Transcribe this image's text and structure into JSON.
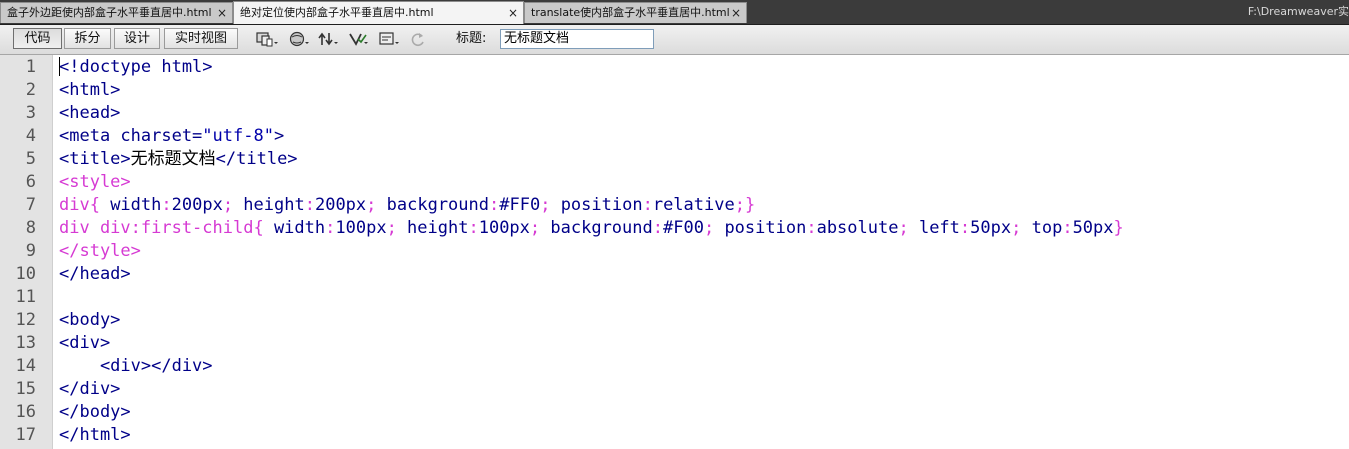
{
  "tabs": [
    {
      "label": "盒子外边距使内部盒子水平垂直居中.html",
      "close": "×",
      "active": false
    },
    {
      "label": "绝对定位使内部盒子水平垂直居中.html",
      "close": "×",
      "active": true
    },
    {
      "label": "translate使内部盒子水平垂直居中.html",
      "close": "×",
      "active": false
    }
  ],
  "site_path": "F:\\Dreamweaver实",
  "toolbar": {
    "view_buttons": [
      "代码",
      "拆分",
      "设计",
      "实时视图"
    ],
    "selected_view": "代码",
    "icons": [
      "multiscreen-icon",
      "preview-browser-icon",
      "file-management-icon",
      "validate-icon",
      "visual-aids-icon",
      "refresh-icon"
    ],
    "title_label": "标题:",
    "title_value": "无标题文档"
  },
  "editor": {
    "line_numbers": [
      "1",
      "2",
      "3",
      "4",
      "5",
      "6",
      "7",
      "8",
      "9",
      "10",
      "11",
      "12",
      "13",
      "14",
      "15",
      "16",
      "17"
    ],
    "colors": {
      "tag": "#000088",
      "style": "#d63ad3",
      "text": "#000000"
    },
    "lines": [
      [
        {
          "t": "<!doctype html>",
          "c": "tag"
        }
      ],
      [
        {
          "t": "<html>",
          "c": "tag"
        }
      ],
      [
        {
          "t": "<head>",
          "c": "tag"
        }
      ],
      [
        {
          "t": "<meta charset=",
          "c": "tag"
        },
        {
          "t": "\"utf-8\"",
          "c": "val"
        },
        {
          "t": ">",
          "c": "tag"
        }
      ],
      [
        {
          "t": "<title>",
          "c": "tag"
        },
        {
          "t": "无标题文档",
          "c": "text"
        },
        {
          "t": "</title>",
          "c": "tag"
        }
      ],
      [
        {
          "t": "<style>",
          "c": "style"
        }
      ],
      [
        {
          "t": "div{ ",
          "c": "style"
        },
        {
          "t": "width",
          "c": "tag"
        },
        {
          "t": ":",
          "c": "style"
        },
        {
          "t": "200px",
          "c": "tag"
        },
        {
          "t": "; ",
          "c": "style"
        },
        {
          "t": "height",
          "c": "tag"
        },
        {
          "t": ":",
          "c": "style"
        },
        {
          "t": "200px",
          "c": "tag"
        },
        {
          "t": "; ",
          "c": "style"
        },
        {
          "t": "background",
          "c": "tag"
        },
        {
          "t": ":",
          "c": "style"
        },
        {
          "t": "#FF0",
          "c": "tag"
        },
        {
          "t": "; ",
          "c": "style"
        },
        {
          "t": "position",
          "c": "tag"
        },
        {
          "t": ":",
          "c": "style"
        },
        {
          "t": "relative",
          "c": "tag"
        },
        {
          "t": ";}",
          "c": "style"
        }
      ],
      [
        {
          "t": "div div:first-child{ ",
          "c": "style"
        },
        {
          "t": "width",
          "c": "tag"
        },
        {
          "t": ":",
          "c": "style"
        },
        {
          "t": "100px",
          "c": "tag"
        },
        {
          "t": "; ",
          "c": "style"
        },
        {
          "t": "height",
          "c": "tag"
        },
        {
          "t": ":",
          "c": "style"
        },
        {
          "t": "100px",
          "c": "tag"
        },
        {
          "t": "; ",
          "c": "style"
        },
        {
          "t": "background",
          "c": "tag"
        },
        {
          "t": ":",
          "c": "style"
        },
        {
          "t": "#F00",
          "c": "tag"
        },
        {
          "t": "; ",
          "c": "style"
        },
        {
          "t": "position",
          "c": "tag"
        },
        {
          "t": ":",
          "c": "style"
        },
        {
          "t": "absolute",
          "c": "tag"
        },
        {
          "t": "; ",
          "c": "style"
        },
        {
          "t": "left",
          "c": "tag"
        },
        {
          "t": ":",
          "c": "style"
        },
        {
          "t": "50px",
          "c": "tag"
        },
        {
          "t": "; ",
          "c": "style"
        },
        {
          "t": "top",
          "c": "tag"
        },
        {
          "t": ":",
          "c": "style"
        },
        {
          "t": "50px",
          "c": "tag"
        },
        {
          "t": "}",
          "c": "style"
        }
      ],
      [
        {
          "t": "</style>",
          "c": "style"
        }
      ],
      [
        {
          "t": "</head>",
          "c": "tag"
        }
      ],
      [],
      [
        {
          "t": "<body>",
          "c": "tag"
        }
      ],
      [
        {
          "t": "<div>",
          "c": "tag"
        }
      ],
      [
        {
          "t": "    <div></div>",
          "c": "tag"
        }
      ],
      [
        {
          "t": "</div>",
          "c": "tag"
        }
      ],
      [
        {
          "t": "</body>",
          "c": "tag"
        }
      ],
      [
        {
          "t": "</html>",
          "c": "tag"
        }
      ]
    ]
  }
}
